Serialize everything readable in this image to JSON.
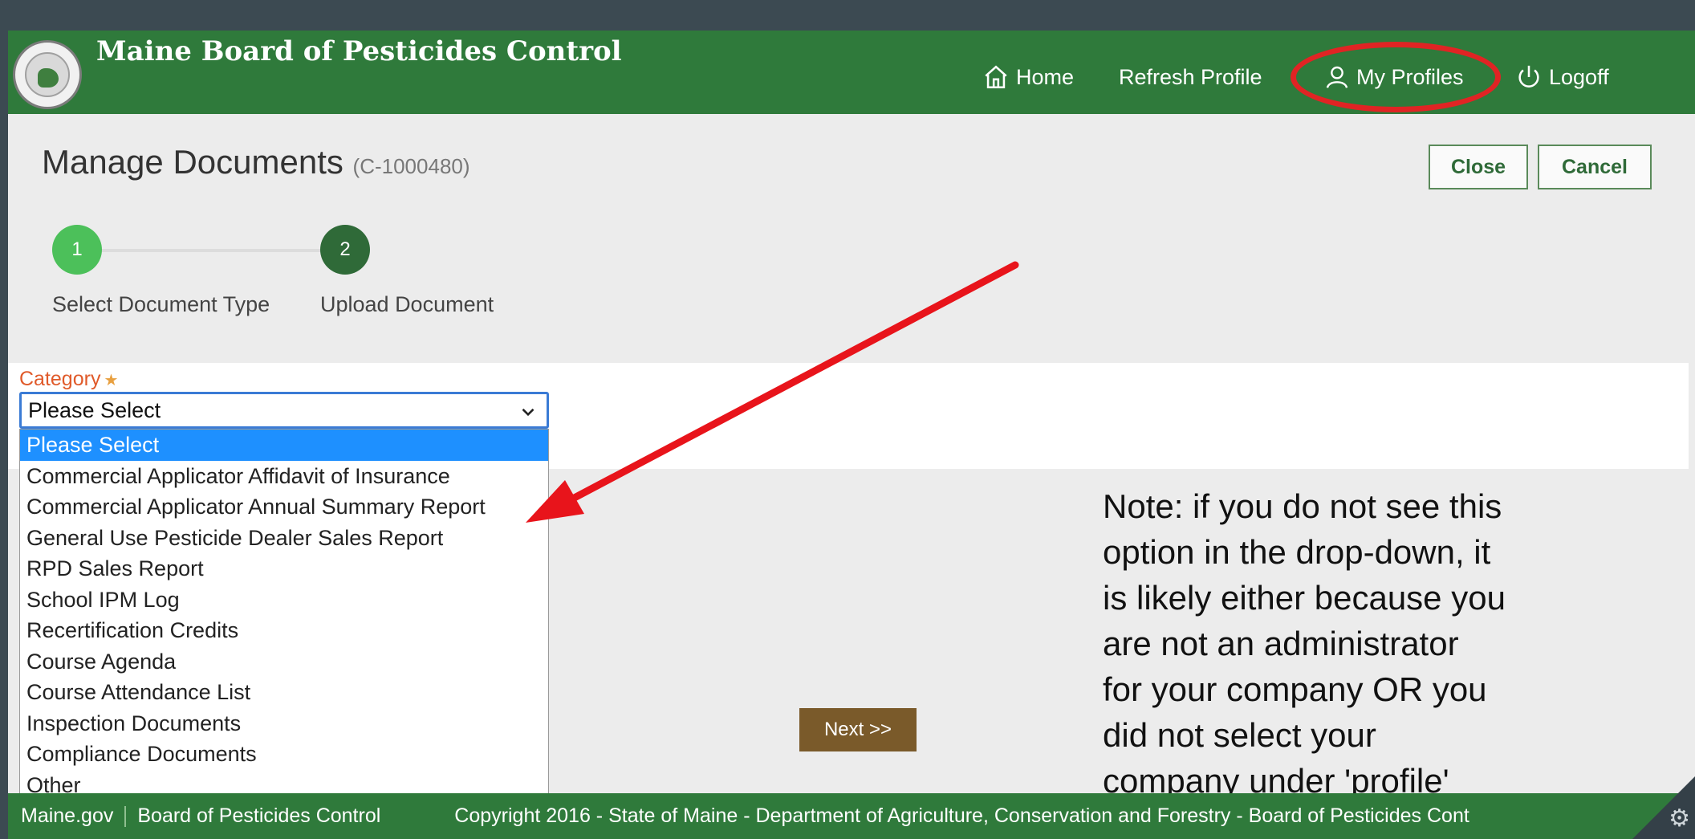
{
  "header": {
    "title": "Maine Board of Pesticides Control",
    "nav": {
      "home": "Home",
      "refresh": "Refresh Profile",
      "profiles": "My Profiles",
      "logoff": "Logoff"
    }
  },
  "page": {
    "title": "Manage Documents",
    "record_id": "(C-1000480)",
    "close_label": "Close",
    "cancel_label": "Cancel"
  },
  "steps": [
    {
      "number": "1",
      "label": "Select Document Type",
      "color": "#4cc05a"
    },
    {
      "number": "2",
      "label": "Upload Document",
      "color": "#2f6a38"
    }
  ],
  "form": {
    "category_label": "Category",
    "required_mark": "★",
    "selected_value": "Please Select",
    "options": [
      "Please Select",
      "Commercial Applicator Affidavit of Insurance",
      "Commercial Applicator Annual Summary Report",
      "General Use Pesticide Dealer Sales Report",
      "RPD Sales Report",
      "School IPM Log",
      "Recertification Credits",
      "Course Agenda",
      "Course Attendance List",
      "Inspection Documents",
      "Compliance Documents",
      "Other"
    ],
    "next_label": "Next >>"
  },
  "note": {
    "lines": [
      "Note: if you do not see this",
      "option in the drop-down, it",
      "is likely either because you",
      "are not an administrator",
      "for your company OR you",
      "did not select your",
      "company under 'profile'"
    ]
  },
  "footer": {
    "link1": "Maine.gov",
    "link2": "Board of Pesticides Control",
    "copyright": "Copyright 2016 - State of Maine - Department of Agriculture, Conservation and Forestry - Board of Pesticides Cont"
  },
  "colors": {
    "header_green": "#2f7a3b",
    "annotation_red": "#e02424",
    "select_highlight": "#1e90ff",
    "next_button": "#7a5a2a"
  }
}
